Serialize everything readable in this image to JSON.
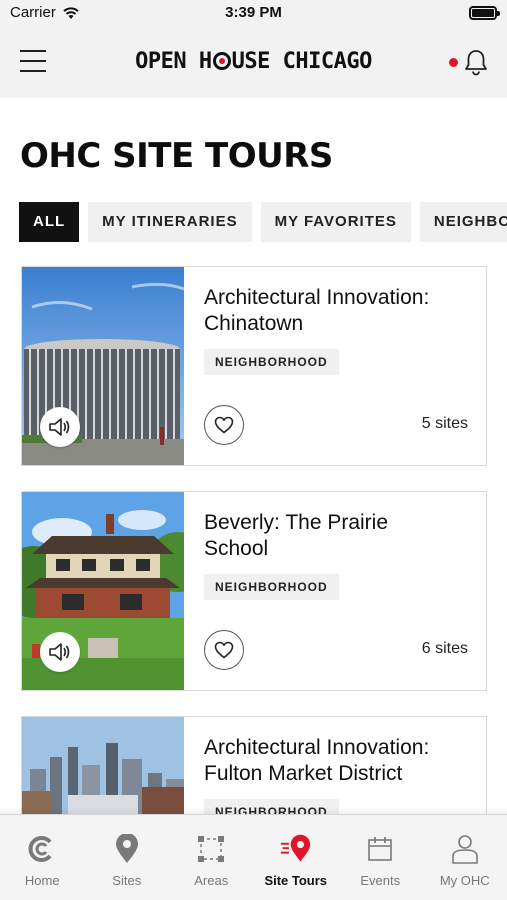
{
  "status_bar": {
    "carrier": "Carrier",
    "time": "3:39 PM"
  },
  "header": {
    "logo_part1": "OPEN H",
    "logo_part2": "USE CHICAGO",
    "notification_dot_color": "#e0162b"
  },
  "page": {
    "title": "OHC SITE TOURS"
  },
  "filters": [
    {
      "label": "ALL",
      "active": true
    },
    {
      "label": "MY ITINERARIES",
      "active": false
    },
    {
      "label": "MY FAVORITES",
      "active": false
    },
    {
      "label": "NEIGHBORHOOD",
      "active": false
    }
  ],
  "tours": [
    {
      "title_line1": "Architectural Innovation:",
      "title_line2": "Chinatown",
      "tag": "NEIGHBORHOOD",
      "sites": "5 sites",
      "image": "library-building-photo"
    },
    {
      "title_line1": "Beverly: The Prairie",
      "title_line2": "School",
      "tag": "NEIGHBORHOOD",
      "sites": "6 sites",
      "image": "prairie-house-photo"
    },
    {
      "title_line1": "Architectural Innovation:",
      "title_line2": "Fulton Market District",
      "tag": "NEIGHBORHOOD",
      "sites": "",
      "image": "city-skyline-photo"
    }
  ],
  "nav": [
    {
      "label": "Home",
      "icon": "home-c-icon",
      "active": false
    },
    {
      "label": "Sites",
      "icon": "map-pin-icon",
      "active": false
    },
    {
      "label": "Areas",
      "icon": "area-select-icon",
      "active": false
    },
    {
      "label": "Site Tours",
      "icon": "site-tours-icon",
      "active": true
    },
    {
      "label": "Events",
      "icon": "calendar-icon",
      "active": false
    },
    {
      "label": "My OHC",
      "icon": "user-icon",
      "active": false
    }
  ],
  "colors": {
    "accent": "#e0162b",
    "chip_active_bg": "#111111",
    "chip_bg": "#f0f0f0"
  }
}
